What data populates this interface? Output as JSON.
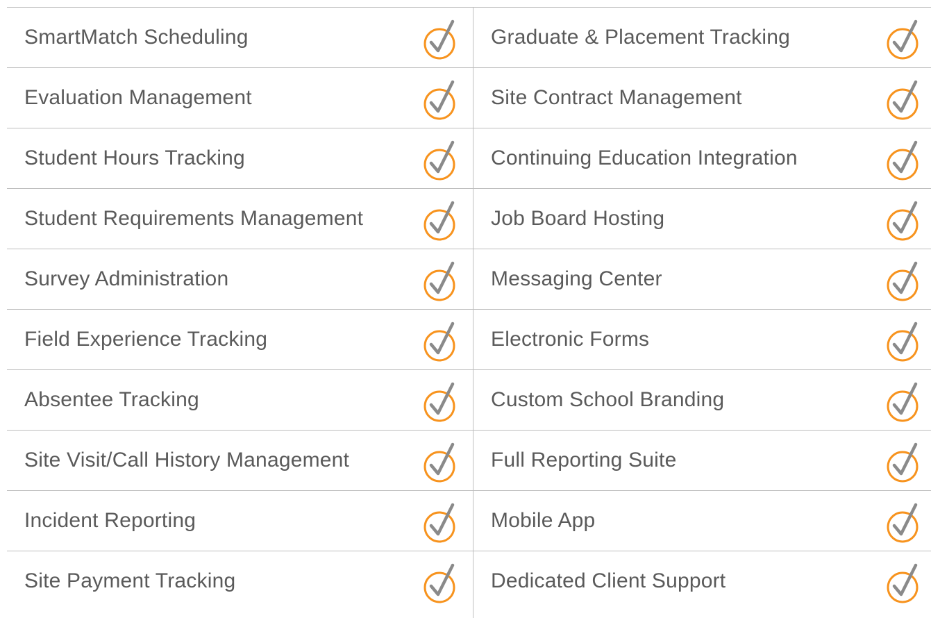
{
  "icon": "checkmark-circle-icon",
  "colors": {
    "circle": "#f7931e",
    "check": "#8a8a8a",
    "text": "#5a5a5a",
    "divider": "#bdbdbd"
  },
  "left_column": [
    {
      "label": "SmartMatch Scheduling"
    },
    {
      "label": "Evaluation Management"
    },
    {
      "label": "Student Hours Tracking"
    },
    {
      "label": "Student Requirements Management"
    },
    {
      "label": "Survey Administration"
    },
    {
      "label": "Field Experience Tracking"
    },
    {
      "label": "Absentee Tracking"
    },
    {
      "label": "Site Visit/Call History Management"
    },
    {
      "label": "Incident Reporting"
    },
    {
      "label": "Site Payment Tracking"
    }
  ],
  "right_column": [
    {
      "label": "Graduate & Placement Tracking"
    },
    {
      "label": "Site Contract Management"
    },
    {
      "label": "Continuing Education Integration"
    },
    {
      "label": "Job Board Hosting"
    },
    {
      "label": "Messaging Center"
    },
    {
      "label": "Electronic Forms"
    },
    {
      "label": "Custom School Branding"
    },
    {
      "label": "Full Reporting Suite"
    },
    {
      "label": "Mobile App"
    },
    {
      "label": "Dedicated Client Support"
    }
  ]
}
